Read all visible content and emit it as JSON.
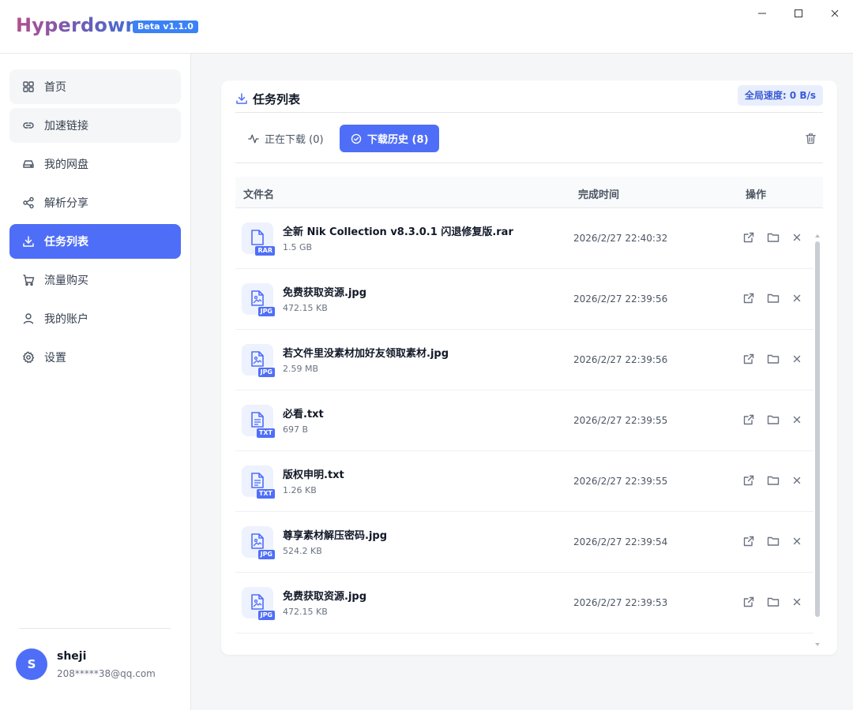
{
  "app": {
    "title": "Hyperdown",
    "version_badge": "Beta v1.1.0"
  },
  "window_controls": [
    "minimize-icon",
    "maximize-icon",
    "close-icon"
  ],
  "sidebar": {
    "items": [
      {
        "label": "首页",
        "icon": "grid-icon",
        "active": false
      },
      {
        "label": "加速链接",
        "icon": "link-icon",
        "active": false
      },
      {
        "label": "我的网盘",
        "icon": "drive-icon",
        "active": false
      },
      {
        "label": "解析分享",
        "icon": "share-icon",
        "active": false
      },
      {
        "label": "任务列表",
        "icon": "download-icon",
        "active": true
      },
      {
        "label": "流量购买",
        "icon": "cart-icon",
        "active": false
      },
      {
        "label": "我的账户",
        "icon": "user-icon",
        "active": false
      },
      {
        "label": "设置",
        "icon": "gear-icon",
        "active": false
      }
    ],
    "user": {
      "avatar_letter": "S",
      "name": "sheji",
      "email": "208*****38@qq.com"
    }
  },
  "main": {
    "title": "任务列表",
    "global_speed": "全局速度: 0 B/s",
    "tabs": [
      {
        "label": "正在下载 (0)",
        "active": false
      },
      {
        "label": "下载历史 (8)",
        "active": true
      }
    ],
    "columns": {
      "name": "文件名",
      "time": "完成时间",
      "actions": "操作"
    },
    "files": [
      {
        "name": "全新 Nik Collection v8.3.0.1 闪退修复版.rar",
        "size": "1.5 GB",
        "ext": "RAR",
        "kind": "file",
        "time": "2026/2/27 22:40:32"
      },
      {
        "name": "免费获取资源.jpg",
        "size": "472.15 KB",
        "ext": "JPG",
        "kind": "image",
        "time": "2026/2/27 22:39:56"
      },
      {
        "name": "若文件里没素材加好友领取素材.jpg",
        "size": "2.59 MB",
        "ext": "JPG",
        "kind": "image",
        "time": "2026/2/27 22:39:56"
      },
      {
        "name": "必看.txt",
        "size": "697 B",
        "ext": "TXT",
        "kind": "text",
        "time": "2026/2/27 22:39:55"
      },
      {
        "name": "版权申明.txt",
        "size": "1.26 KB",
        "ext": "TXT",
        "kind": "text",
        "time": "2026/2/27 22:39:55"
      },
      {
        "name": "尊享素材解压密码.jpg",
        "size": "524.2 KB",
        "ext": "JPG",
        "kind": "image",
        "time": "2026/2/27 22:39:54"
      },
      {
        "name": "免费获取资源.jpg",
        "size": "472.15 KB",
        "ext": "JPG",
        "kind": "image",
        "time": "2026/2/27 22:39:53"
      }
    ]
  },
  "colors": {
    "accent": "#4f6ef7",
    "badge_blue": "#3b82f6",
    "speed_bg": "#e8eefc"
  }
}
